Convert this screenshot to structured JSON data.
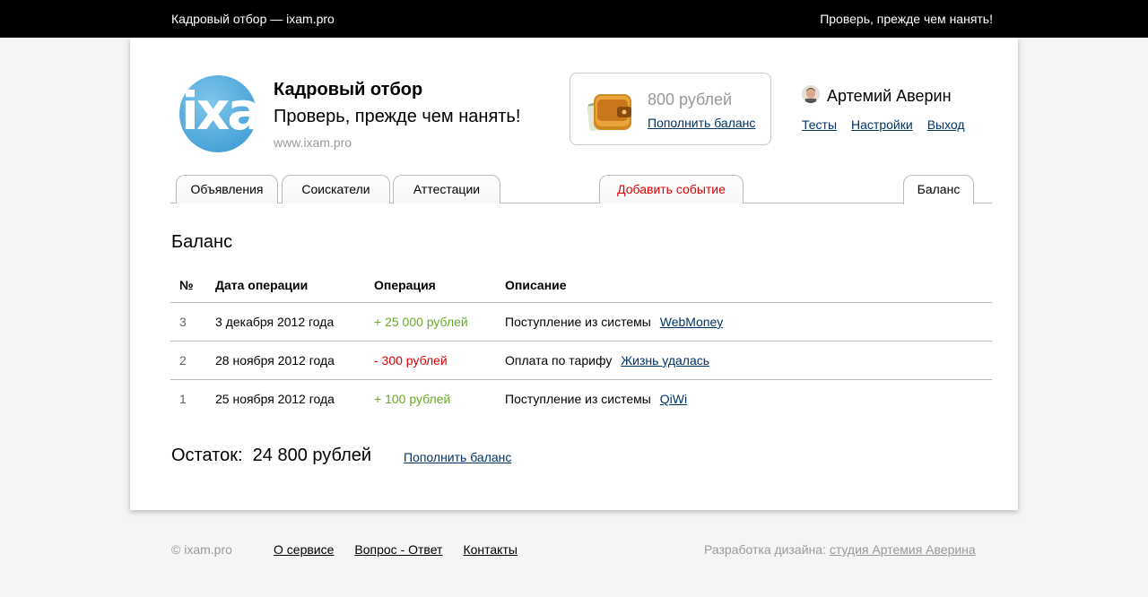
{
  "topbar": {
    "left_text": "Кадровый отбор — ixam.pro",
    "right_text": "Проверь, прежде чем нанять!"
  },
  "brand": {
    "logo_text": "ixa",
    "title": "Кадровый отбор",
    "slogan": "Проверь, прежде чем нанять!",
    "url": "www.ixam.pro"
  },
  "wallet": {
    "amount": "800 рублей",
    "topup_label": "Пополнить баланс",
    "icon": "wallet-icon"
  },
  "user": {
    "name": "Артемий Аверин",
    "links": [
      "Тесты",
      "Настройки",
      "Выход"
    ]
  },
  "tabs": [
    {
      "label": "Объявления"
    },
    {
      "label": "Соискатели"
    },
    {
      "label": "Аттестации"
    },
    {
      "label": "Добавить событие"
    },
    {
      "label": "Баланс"
    }
  ],
  "page_title": "Баланс",
  "table": {
    "headers": [
      "№",
      "Дата операции",
      "Операция",
      "Описание"
    ],
    "rows": [
      {
        "num": "3",
        "date": "3 декабря 2012 года",
        "operation": "+ 25 000 рублей",
        "description": "Поступление из системы",
        "link": "WebMoney"
      },
      {
        "num": "2",
        "date": "28 ноября 2012 года",
        "operation": "- 300 рублей",
        "description": "Оплата по тарифу",
        "link": "Жизнь удалась"
      },
      {
        "num": "1",
        "date": "25 ноября 2012 года",
        "operation": "+ 100 рублей",
        "description": "Поступление из системы",
        "link": "QiWi"
      }
    ]
  },
  "balance": {
    "label": "Остаток:",
    "value": "24 800 рублей",
    "topup_label": "Пополнить баланс"
  },
  "footer": {
    "copyright": "© ixam.pro",
    "links": [
      "О сервисе",
      "Вопрос - Ответ",
      "Контакты"
    ],
    "credit_prefix": "Разработка дизайна:",
    "credit_link": "студия Артемия Аверина"
  },
  "colors": {
    "accent_link": "#003366",
    "positive": "#6aa82a",
    "negative": "#e00000",
    "logo_blue": "#4aa4d8"
  }
}
